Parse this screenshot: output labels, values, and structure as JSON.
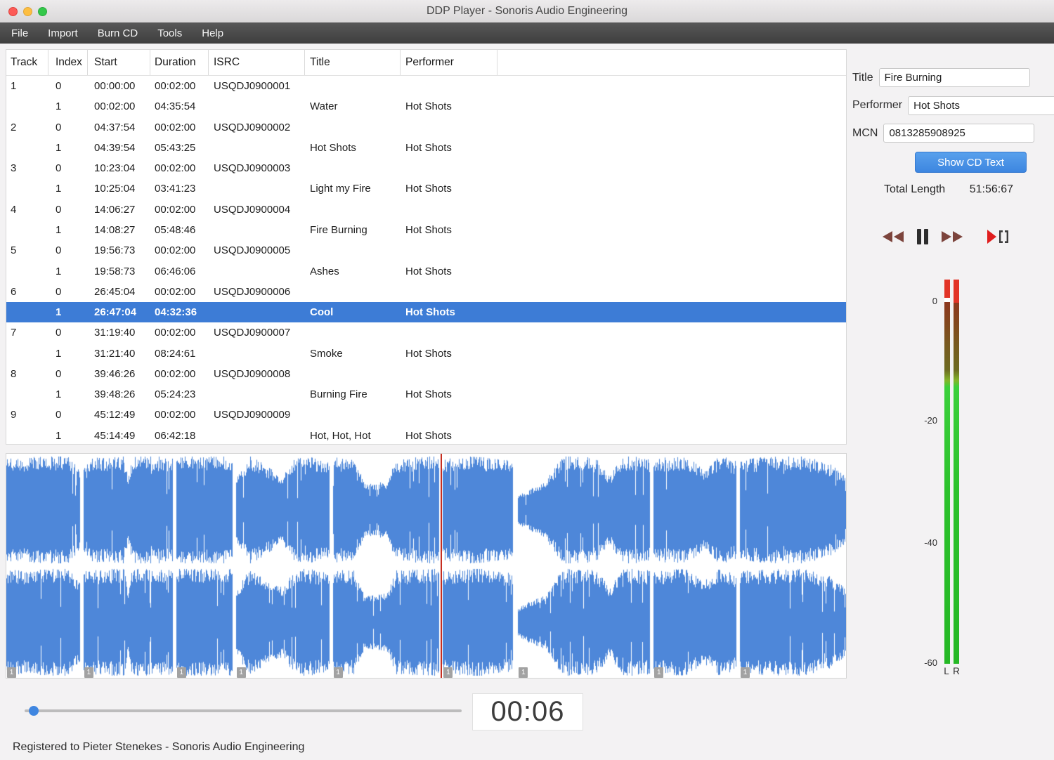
{
  "colors": {
    "selection": "#3d7cd6",
    "waveform": "#4e87d9",
    "button_top": "#58a0ec",
    "button_bottom": "#3d86e0"
  },
  "window": {
    "title": "DDP Player - Sonoris Audio Engineering",
    "status_bar": "Registered to Pieter Stenekes - Sonoris Audio Engineering"
  },
  "titlebar_icons": [
    "close-icon",
    "minimize-icon",
    "zoom-icon"
  ],
  "menu": {
    "items": [
      "File",
      "Import",
      "Burn CD",
      "Tools",
      "Help"
    ]
  },
  "table": {
    "columns": [
      "Track",
      "Index",
      "Start",
      "Duration",
      "ISRC",
      "Title",
      "Performer"
    ],
    "rows": [
      {
        "track": "1",
        "index": "0",
        "start": "00:00:00",
        "duration": "00:02:00",
        "isrc": "USQDJ0900001",
        "title": "",
        "performer": ""
      },
      {
        "track": "",
        "index": "1",
        "start": "00:02:00",
        "duration": "04:35:54",
        "isrc": "",
        "title": "Water",
        "performer": "Hot Shots"
      },
      {
        "track": "2",
        "index": "0",
        "start": "04:37:54",
        "duration": "00:02:00",
        "isrc": "USQDJ0900002",
        "title": "",
        "performer": ""
      },
      {
        "track": "",
        "index": "1",
        "start": "04:39:54",
        "duration": "05:43:25",
        "isrc": "",
        "title": "Hot Shots",
        "performer": "Hot Shots"
      },
      {
        "track": "3",
        "index": "0",
        "start": "10:23:04",
        "duration": "00:02:00",
        "isrc": "USQDJ0900003",
        "title": "",
        "performer": ""
      },
      {
        "track": "",
        "index": "1",
        "start": "10:25:04",
        "duration": "03:41:23",
        "isrc": "",
        "title": "Light my Fire",
        "performer": "Hot Shots"
      },
      {
        "track": "4",
        "index": "0",
        "start": "14:06:27",
        "duration": "00:02:00",
        "isrc": "USQDJ0900004",
        "title": "",
        "performer": ""
      },
      {
        "track": "",
        "index": "1",
        "start": "14:08:27",
        "duration": "05:48:46",
        "isrc": "",
        "title": "Fire Burning",
        "performer": "Hot Shots"
      },
      {
        "track": "5",
        "index": "0",
        "start": "19:56:73",
        "duration": "00:02:00",
        "isrc": "USQDJ0900005",
        "title": "",
        "performer": ""
      },
      {
        "track": "",
        "index": "1",
        "start": "19:58:73",
        "duration": "06:46:06",
        "isrc": "",
        "title": "Ashes",
        "performer": "Hot Shots"
      },
      {
        "track": "6",
        "index": "0",
        "start": "26:45:04",
        "duration": "00:02:00",
        "isrc": "USQDJ0900006",
        "title": "",
        "performer": ""
      },
      {
        "track": "",
        "index": "1",
        "start": "26:47:04",
        "duration": "04:32:36",
        "isrc": "",
        "title": "Cool",
        "performer": "Hot Shots",
        "selected": true
      },
      {
        "track": "7",
        "index": "0",
        "start": "31:19:40",
        "duration": "00:02:00",
        "isrc": "USQDJ0900007",
        "title": "",
        "performer": ""
      },
      {
        "track": "",
        "index": "1",
        "start": "31:21:40",
        "duration": "08:24:61",
        "isrc": "",
        "title": "Smoke",
        "performer": "Hot Shots"
      },
      {
        "track": "8",
        "index": "0",
        "start": "39:46:26",
        "duration": "00:02:00",
        "isrc": "USQDJ0900008",
        "title": "",
        "performer": ""
      },
      {
        "track": "",
        "index": "1",
        "start": "39:48:26",
        "duration": "05:24:23",
        "isrc": "",
        "title": "Burning Fire",
        "performer": "Hot Shots"
      },
      {
        "track": "9",
        "index": "0",
        "start": "45:12:49",
        "duration": "00:02:00",
        "isrc": "USQDJ0900009",
        "title": "",
        "performer": ""
      },
      {
        "track": "",
        "index": "1",
        "start": "45:14:49",
        "duration": "06:42:18",
        "isrc": "",
        "title": "Hot, Hot, Hot",
        "performer": "Hot Shots"
      }
    ]
  },
  "side_panel": {
    "fields": [
      {
        "label": "Title",
        "value": "Fire Burning"
      },
      {
        "label": "Performer",
        "value": "Hot Shots"
      },
      {
        "label": "MCN",
        "value": "0813285908925"
      }
    ],
    "show_cd_text_button": "Show CD Text",
    "total_length_label": "Total Length",
    "total_length_value": "51:56:67",
    "meter": {
      "scale_labels": [
        "0",
        "-20",
        "-40",
        "-60"
      ],
      "channel_labels": [
        "L",
        "R"
      ]
    }
  },
  "transport": {
    "icons": [
      "rewind-icon",
      "pause-icon",
      "fast-forward-icon",
      "play-to-marker-icon"
    ]
  },
  "playback": {
    "time_display": "00:06",
    "slider_fraction": 0.01
  },
  "waveform": {
    "playhead_fraction": 0.5175,
    "segments": [
      {
        "label": "1",
        "start": 0.0,
        "end": 0.0878,
        "env": [
          [
            0,
            0.9
          ],
          [
            0.85,
            0.95
          ],
          [
            1,
            0.7
          ]
        ]
      },
      {
        "label": "1",
        "start": 0.092,
        "end": 0.1981,
        "env": [
          [
            0,
            0.9
          ],
          [
            0.45,
            0.95
          ],
          [
            0.5,
            0.55
          ],
          [
            0.55,
            0.95
          ],
          [
            1,
            0.92
          ]
        ]
      },
      {
        "label": "1",
        "start": 0.2023,
        "end": 0.2692,
        "env": [
          [
            0,
            0.95
          ],
          [
            1,
            0.95
          ]
        ]
      },
      {
        "label": "1",
        "start": 0.2734,
        "end": 0.3847,
        "env": [
          [
            0,
            0.55
          ],
          [
            0.15,
            0.95
          ],
          [
            0.5,
            0.6
          ],
          [
            0.65,
            0.95
          ],
          [
            1,
            0.88
          ]
        ]
      },
      {
        "label": "1",
        "start": 0.3888,
        "end": 0.5158,
        "env": [
          [
            0,
            0.92
          ],
          [
            0.2,
            0.9
          ],
          [
            0.3,
            0.45
          ],
          [
            0.5,
            0.5
          ],
          [
            0.6,
            0.9
          ],
          [
            1,
            0.95
          ]
        ]
      },
      {
        "label": "1",
        "start": 0.52,
        "end": 0.6036,
        "env": [
          [
            0,
            0.9
          ],
          [
            0.5,
            0.95
          ],
          [
            1,
            0.85
          ]
        ]
      },
      {
        "label": "1",
        "start": 0.6095,
        "end": 0.7667,
        "env": [
          [
            0,
            0.25
          ],
          [
            0.2,
            0.5
          ],
          [
            0.35,
            0.95
          ],
          [
            0.6,
            0.9
          ],
          [
            0.7,
            0.6
          ],
          [
            0.8,
            0.95
          ],
          [
            1,
            0.9
          ]
        ]
      },
      {
        "label": "1",
        "start": 0.7709,
        "end": 0.8695,
        "env": [
          [
            0,
            0.9
          ],
          [
            0.4,
            0.95
          ],
          [
            0.6,
            0.7
          ],
          [
            0.8,
            0.95
          ],
          [
            1,
            0.85
          ]
        ]
      },
      {
        "label": "1",
        "start": 0.8737,
        "end": 1.0,
        "env": [
          [
            0,
            0.9
          ],
          [
            0.6,
            0.95
          ],
          [
            0.85,
            0.8
          ],
          [
            1,
            0.6
          ]
        ]
      }
    ]
  }
}
